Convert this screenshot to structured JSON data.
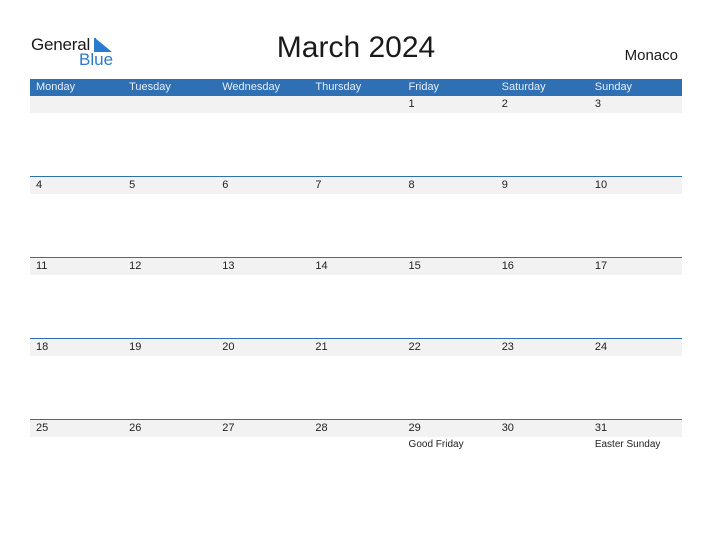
{
  "logo": {
    "word1": "General",
    "word2": "Blue"
  },
  "title": "March 2024",
  "country": "Monaco",
  "colors": {
    "accent": "#2e70b3",
    "band": "#f2f2f2",
    "logo_blue": "#2a7bd0"
  },
  "weekdays": [
    "Monday",
    "Tuesday",
    "Wednesday",
    "Thursday",
    "Friday",
    "Saturday",
    "Sunday"
  ],
  "weeks": [
    [
      {
        "day": ""
      },
      {
        "day": ""
      },
      {
        "day": ""
      },
      {
        "day": ""
      },
      {
        "day": "1"
      },
      {
        "day": "2"
      },
      {
        "day": "3"
      }
    ],
    [
      {
        "day": "4"
      },
      {
        "day": "5"
      },
      {
        "day": "6"
      },
      {
        "day": "7"
      },
      {
        "day": "8"
      },
      {
        "day": "9"
      },
      {
        "day": "10"
      }
    ],
    [
      {
        "day": "11"
      },
      {
        "day": "12"
      },
      {
        "day": "13"
      },
      {
        "day": "14"
      },
      {
        "day": "15"
      },
      {
        "day": "16"
      },
      {
        "day": "17"
      }
    ],
    [
      {
        "day": "18"
      },
      {
        "day": "19"
      },
      {
        "day": "20"
      },
      {
        "day": "21"
      },
      {
        "day": "22"
      },
      {
        "day": "23"
      },
      {
        "day": "24"
      }
    ],
    [
      {
        "day": "25"
      },
      {
        "day": "26"
      },
      {
        "day": "27"
      },
      {
        "day": "28"
      },
      {
        "day": "29",
        "holiday": "Good Friday"
      },
      {
        "day": "30"
      },
      {
        "day": "31",
        "holiday": "Easter Sunday"
      }
    ]
  ]
}
